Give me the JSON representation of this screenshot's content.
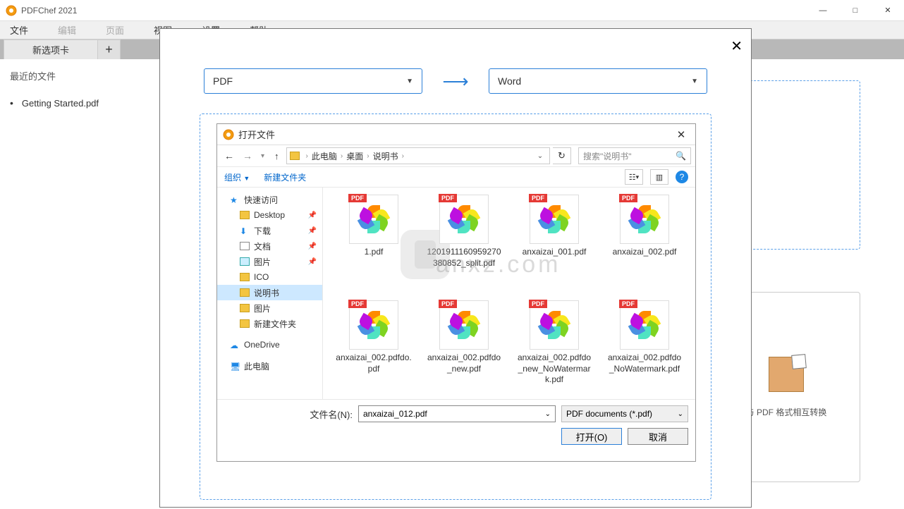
{
  "title_bar": {
    "title": "PDFChef 2021"
  },
  "menu": {
    "file": "文件",
    "edit": "编辑",
    "page": "页面",
    "view": "视图",
    "settings": "设置",
    "help": "帮助"
  },
  "tabs": {
    "new_tab": "新选项卡"
  },
  "recent": {
    "label": "最近的文件",
    "item0": "Getting Started.pdf"
  },
  "right_card2": {
    "text": "与 PDF 格式相互转换"
  },
  "convert": {
    "from": "PDF",
    "to": "Word"
  },
  "open_dialog": {
    "title": "打开文件",
    "path_pc": "此电脑",
    "path_desktop": "桌面",
    "path_folder": "说明书",
    "search_placeholder": "搜索\"说明书\"",
    "organize": "组织",
    "new_folder": "新建文件夹",
    "side": {
      "quick": "快速访问",
      "desktop": "Desktop",
      "downloads": "下载",
      "documents": "文档",
      "pictures": "图片",
      "ico": "ICO",
      "manual": "说明书",
      "pictures2": "图片",
      "newfolder": "新建文件夹",
      "onedrive": "OneDrive",
      "thispc": "此电脑"
    },
    "files": {
      "f0": "1.pdf",
      "f1": "1201911160959270380852_split.pdf",
      "f2": "anxaizai_001.pdf",
      "f3": "anxaizai_002.pdf",
      "f4": "anxaizai_002.pdfdo.pdf",
      "f5": "anxaizai_002.pdfdo_new.pdf",
      "f6": "anxaizai_002.pdfdo_new_NoWatermark.pdf",
      "f7": "anxaizai_002.pdfdo_NoWatermark.pdf"
    },
    "filename_label": "文件名(N):",
    "filename_value": "anxaizai_012.pdf",
    "filter": "PDF documents (*.pdf)",
    "open_btn": "打开(O)",
    "cancel_btn": "取消"
  },
  "watermark": "anxz.com"
}
